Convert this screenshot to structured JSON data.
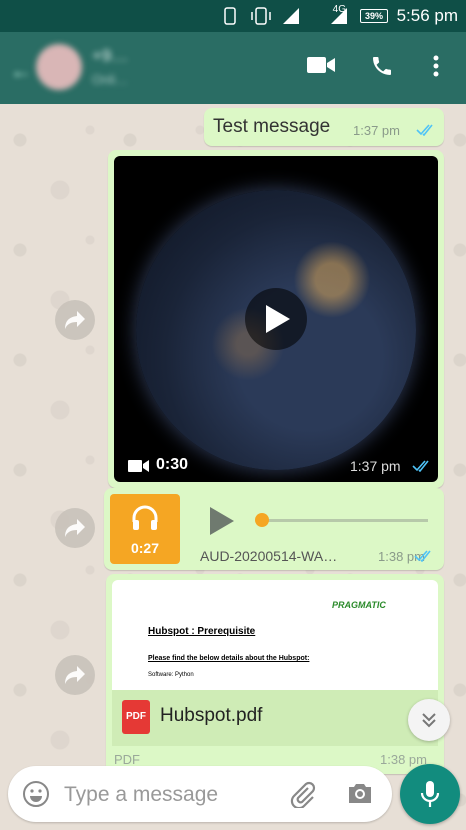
{
  "status_bar": {
    "network": "4G",
    "battery": "39%",
    "time": "5:56 pm"
  },
  "header": {
    "name": "+9…",
    "status": "Onli…",
    "icons": [
      "back-arrow-icon",
      "video-call-icon",
      "phone-icon",
      "more-vert-icon"
    ]
  },
  "messages": {
    "text_message": {
      "text": "Test message",
      "time": "1:37 pm",
      "ticks": "read"
    },
    "video_message": {
      "duration": "0:30",
      "time": "1:37 pm",
      "ticks": "read"
    },
    "audio_message": {
      "duration": "0:27",
      "filename": "AUD-20200514-WA…",
      "time": "1:38 pm",
      "ticks": "read",
      "progress": 0
    },
    "document_message": {
      "preview": {
        "logo": "PRAGMATIC",
        "heading": "Hubspot : Prerequisite",
        "subheading": "Please find the below details about the Hubspot:",
        "line": "Software:  Python"
      },
      "filename": "Hubspot.pdf",
      "icon_label": "PDF",
      "type": "PDF",
      "time": "1:38 pm"
    }
  },
  "composer": {
    "placeholder": "Type a message"
  },
  "colors": {
    "header": "#2a6d64",
    "bubble": "#dcf8c6",
    "accent": "#128c7e",
    "audio_tile": "#f5a623",
    "tick": "#4fc3f7"
  }
}
